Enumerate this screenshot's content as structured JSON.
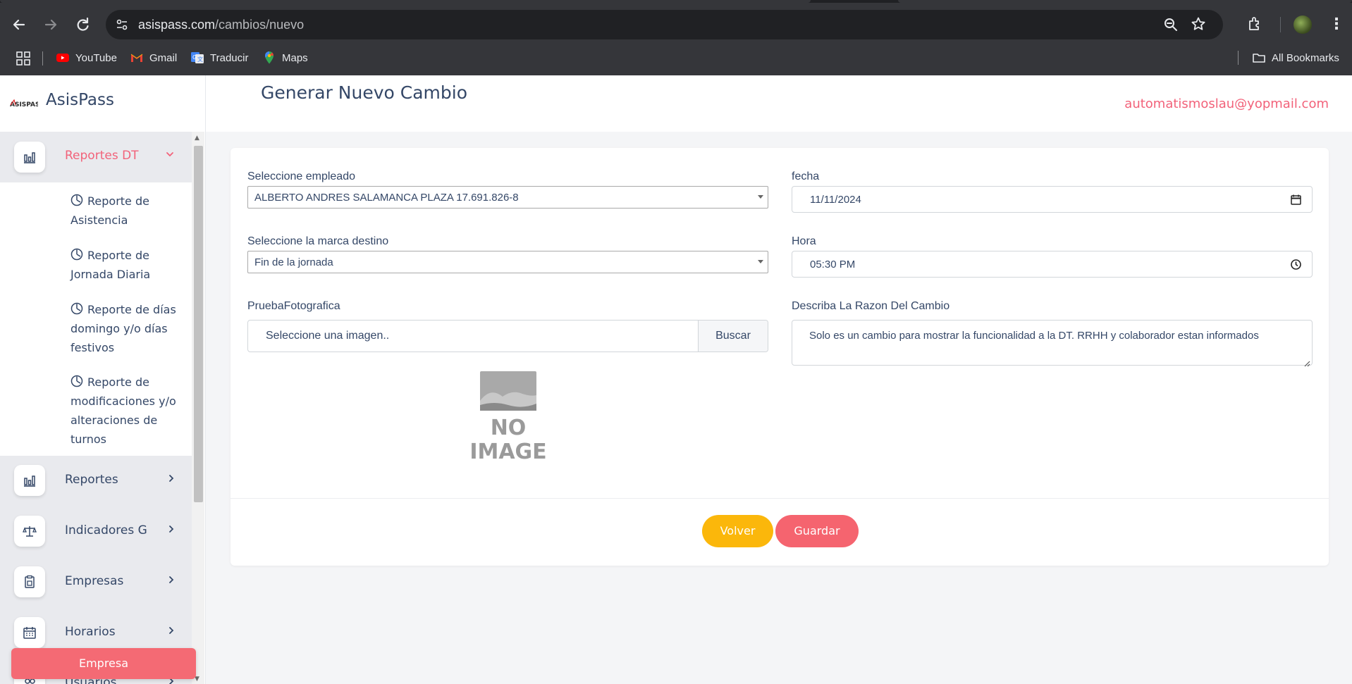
{
  "browser": {
    "url_host": "asispass.com",
    "url_path": "/cambios/nuevo",
    "bookmarks": [
      {
        "label": "YouTube",
        "icon": "youtube-icon"
      },
      {
        "label": "Gmail",
        "icon": "gmail-icon"
      },
      {
        "label": "Traducir",
        "icon": "translate-icon"
      },
      {
        "label": "Maps",
        "icon": "maps-icon"
      }
    ],
    "all_bookmarks_label": "All Bookmarks"
  },
  "sidebar": {
    "brand_name": "AsisPass",
    "logo_text": "ASISPASS",
    "active_section": {
      "label": "Reportes DT",
      "icon": "bar-chart-icon"
    },
    "subitems": [
      {
        "label": "Reporte de Asistencia"
      },
      {
        "label": "Reporte de Jornada Diaria"
      },
      {
        "label": "Reporte de días domingo y/o días festivos"
      },
      {
        "label": "Reporte de modificaciones y/o alteraciones de turnos"
      }
    ],
    "items": [
      {
        "label": "Reportes",
        "icon": "bar-chart-icon"
      },
      {
        "label": "Indicadores G",
        "icon": "scale-icon"
      },
      {
        "label": "Empresas",
        "icon": "clipboard-icon"
      },
      {
        "label": "Horarios",
        "icon": "calendar-icon"
      },
      {
        "label": "Usuarios",
        "icon": "users-icon"
      }
    ],
    "empresa_button": "Empresa"
  },
  "header": {
    "title": "Generar Nuevo Cambio",
    "user_email": "automatismoslau@yopmail.com"
  },
  "form": {
    "employee_label": "Seleccione empleado",
    "employee_value": "ALBERTO ANDRES SALAMANCA PLAZA 17.691.826-8",
    "date_label": "fecha",
    "date_value": "11/11/2024",
    "destination_label": "Seleccione la marca destino",
    "destination_value": "Fin de la jornada",
    "time_label": "Hora",
    "time_value": "05:30 PM",
    "photo_label": "PruebaFotografica",
    "photo_placeholder": "Seleccione una imagen..",
    "photo_button": "Buscar",
    "reason_label": "Describa La Razon Del Cambio",
    "reason_value": "Solo es un cambio para mostrar la funcionalidad a la DT. RRHH y colaborador estan informados",
    "no_image_text_line1": "NO",
    "no_image_text_line2": "IMAGE",
    "back_button": "Volver",
    "save_button": "Guardar"
  },
  "colors": {
    "accent": "#f2627a",
    "save": "#f5646f",
    "back": "#fbb70b",
    "text": "#344767"
  }
}
